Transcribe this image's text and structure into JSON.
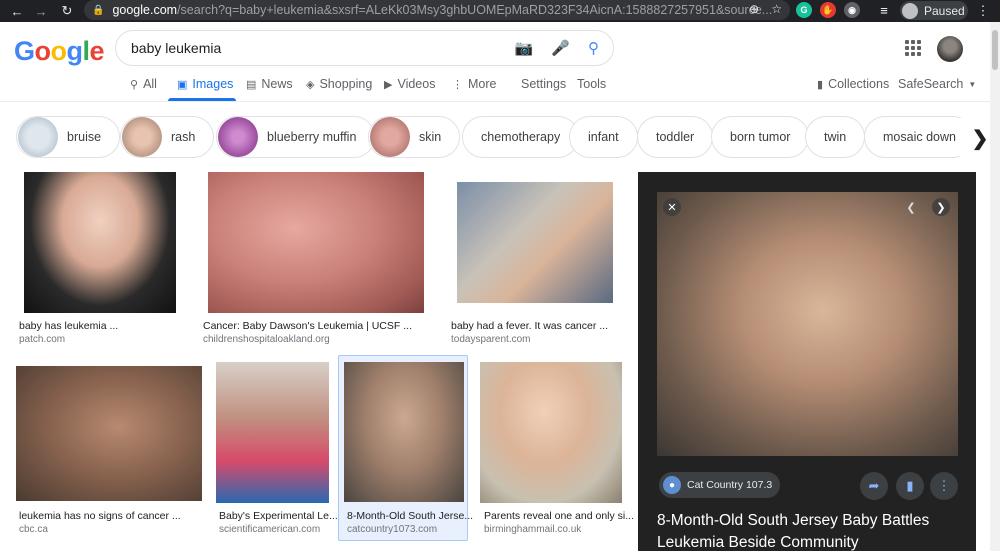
{
  "browser": {
    "url_host": "google.com",
    "url_path": "/search?q=baby+leukemia&sxsrf=ALeKk03Msy3ghbUOMEpMaRD323F34AicnA:1588827257951&source...",
    "profile_status": "Paused"
  },
  "search": {
    "query": "baby leukemia"
  },
  "logo": {
    "letters": [
      "G",
      "o",
      "o",
      "g",
      "l",
      "e"
    ],
    "colors": [
      "#4285f4",
      "#ea4335",
      "#fbbc05",
      "#4285f4",
      "#34a853",
      "#ea4335"
    ]
  },
  "tabs": [
    {
      "label": "All",
      "icon": "search-icon"
    },
    {
      "label": "Images",
      "icon": "image-icon",
      "active": true
    },
    {
      "label": "News",
      "icon": "news-icon"
    },
    {
      "label": "Shopping",
      "icon": "tag-icon"
    },
    {
      "label": "Videos",
      "icon": "video-icon"
    },
    {
      "label": "More",
      "icon": "more-vert-icon"
    },
    {
      "label": "Settings"
    },
    {
      "label": "Tools"
    }
  ],
  "header_right": {
    "collections": "Collections",
    "safesearch": "SafeSearch"
  },
  "chips": [
    {
      "label": "bruise"
    },
    {
      "label": "rash"
    },
    {
      "label": "blueberry muffin"
    },
    {
      "label": "skin"
    },
    {
      "label": "chemotherapy"
    },
    {
      "label": "infant"
    },
    {
      "label": "toddler"
    },
    {
      "label": "born tumor"
    },
    {
      "label": "twin"
    },
    {
      "label": "mosaic down syndrome"
    }
  ],
  "results": [
    {
      "title": "baby has leukemia ...",
      "source": "patch.com"
    },
    {
      "title": "Cancer: Baby Dawson's Leukemia | UCSF ...",
      "source": "childrenshospitaloakland.org"
    },
    {
      "title": "baby had a fever. It was cancer ...",
      "source": "todaysparent.com"
    },
    {
      "title": "leukemia has no signs of cancer ...",
      "source": "cbc.ca"
    },
    {
      "title": "Baby's Experimental Le...",
      "source": "scientificamerican.com"
    },
    {
      "title": "8-Month-Old South Jerse...",
      "source": "catcountry1073.com"
    },
    {
      "title": "Parents reveal one and only si...",
      "source": "birminghammail.co.uk"
    }
  ],
  "preview": {
    "source_name": "Cat Country 107.3",
    "title": "8-Month-Old South Jersey Baby Battles Leukemia Beside Community"
  },
  "colors": {
    "accent": "#1a73e8",
    "panel_bg": "#222222"
  }
}
